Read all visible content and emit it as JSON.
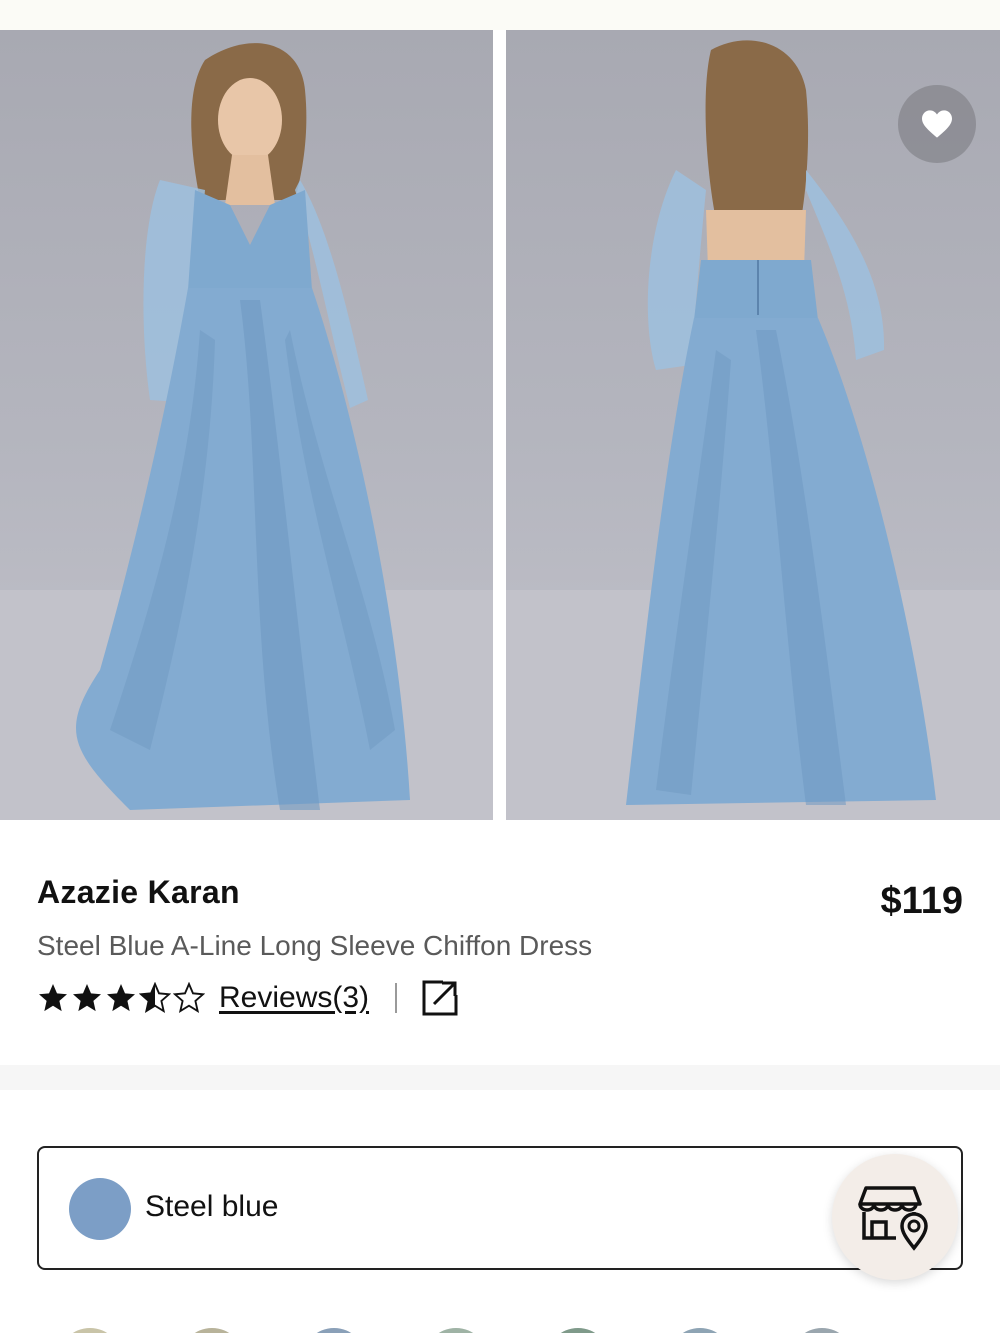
{
  "product": {
    "brand": "Azazie Karan",
    "subtitle": "Steel Blue A-Line Long Sleeve Chiffon Dress",
    "price": "$119",
    "rating": 3.5,
    "rating_max": 5,
    "reviews_label": "Reviews(3)"
  },
  "gallery": {
    "images": [
      {
        "name": "front view"
      },
      {
        "name": "back view"
      }
    ],
    "favorite_icon": "heart-icon"
  },
  "color_selector": {
    "selected_name": "Steel blue",
    "selected_hex": "#7c9ec6"
  },
  "icons": {
    "share": "external-link-icon",
    "store": "store-locator-icon"
  },
  "colors": {
    "dress": "#7fa9cf",
    "text_primary": "#111111",
    "text_secondary": "#5a5a5a",
    "store_button_bg": "#f3ede8"
  }
}
